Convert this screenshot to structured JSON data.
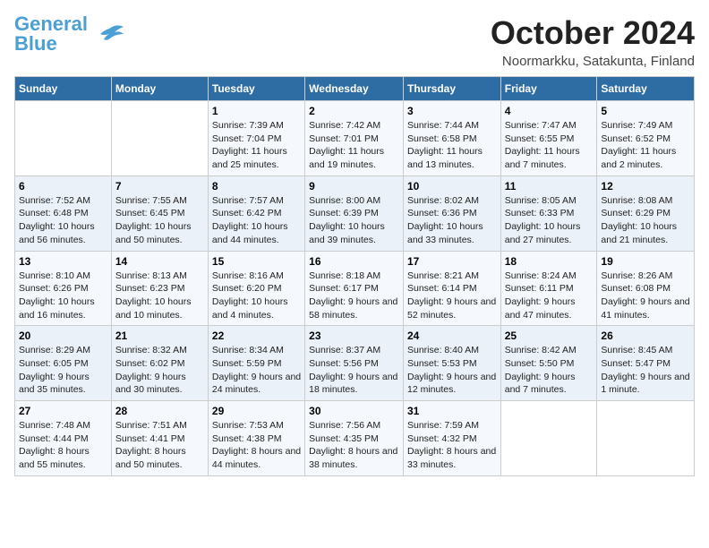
{
  "logo": {
    "line1": "General",
    "line2": "Blue"
  },
  "title": {
    "month_year": "October 2024",
    "location": "Noormarkku, Satakunta, Finland"
  },
  "days_of_week": [
    "Sunday",
    "Monday",
    "Tuesday",
    "Wednesday",
    "Thursday",
    "Friday",
    "Saturday"
  ],
  "weeks": [
    [
      {
        "day": "",
        "sunrise": "",
        "sunset": "",
        "daylight": ""
      },
      {
        "day": "",
        "sunrise": "",
        "sunset": "",
        "daylight": ""
      },
      {
        "day": "1",
        "sunrise": "Sunrise: 7:39 AM",
        "sunset": "Sunset: 7:04 PM",
        "daylight": "Daylight: 11 hours and 25 minutes."
      },
      {
        "day": "2",
        "sunrise": "Sunrise: 7:42 AM",
        "sunset": "Sunset: 7:01 PM",
        "daylight": "Daylight: 11 hours and 19 minutes."
      },
      {
        "day": "3",
        "sunrise": "Sunrise: 7:44 AM",
        "sunset": "Sunset: 6:58 PM",
        "daylight": "Daylight: 11 hours and 13 minutes."
      },
      {
        "day": "4",
        "sunrise": "Sunrise: 7:47 AM",
        "sunset": "Sunset: 6:55 PM",
        "daylight": "Daylight: 11 hours and 7 minutes."
      },
      {
        "day": "5",
        "sunrise": "Sunrise: 7:49 AM",
        "sunset": "Sunset: 6:52 PM",
        "daylight": "Daylight: 11 hours and 2 minutes."
      }
    ],
    [
      {
        "day": "6",
        "sunrise": "Sunrise: 7:52 AM",
        "sunset": "Sunset: 6:48 PM",
        "daylight": "Daylight: 10 hours and 56 minutes."
      },
      {
        "day": "7",
        "sunrise": "Sunrise: 7:55 AM",
        "sunset": "Sunset: 6:45 PM",
        "daylight": "Daylight: 10 hours and 50 minutes."
      },
      {
        "day": "8",
        "sunrise": "Sunrise: 7:57 AM",
        "sunset": "Sunset: 6:42 PM",
        "daylight": "Daylight: 10 hours and 44 minutes."
      },
      {
        "day": "9",
        "sunrise": "Sunrise: 8:00 AM",
        "sunset": "Sunset: 6:39 PM",
        "daylight": "Daylight: 10 hours and 39 minutes."
      },
      {
        "day": "10",
        "sunrise": "Sunrise: 8:02 AM",
        "sunset": "Sunset: 6:36 PM",
        "daylight": "Daylight: 10 hours and 33 minutes."
      },
      {
        "day": "11",
        "sunrise": "Sunrise: 8:05 AM",
        "sunset": "Sunset: 6:33 PM",
        "daylight": "Daylight: 10 hours and 27 minutes."
      },
      {
        "day": "12",
        "sunrise": "Sunrise: 8:08 AM",
        "sunset": "Sunset: 6:29 PM",
        "daylight": "Daylight: 10 hours and 21 minutes."
      }
    ],
    [
      {
        "day": "13",
        "sunrise": "Sunrise: 8:10 AM",
        "sunset": "Sunset: 6:26 PM",
        "daylight": "Daylight: 10 hours and 16 minutes."
      },
      {
        "day": "14",
        "sunrise": "Sunrise: 8:13 AM",
        "sunset": "Sunset: 6:23 PM",
        "daylight": "Daylight: 10 hours and 10 minutes."
      },
      {
        "day": "15",
        "sunrise": "Sunrise: 8:16 AM",
        "sunset": "Sunset: 6:20 PM",
        "daylight": "Daylight: 10 hours and 4 minutes."
      },
      {
        "day": "16",
        "sunrise": "Sunrise: 8:18 AM",
        "sunset": "Sunset: 6:17 PM",
        "daylight": "Daylight: 9 hours and 58 minutes."
      },
      {
        "day": "17",
        "sunrise": "Sunrise: 8:21 AM",
        "sunset": "Sunset: 6:14 PM",
        "daylight": "Daylight: 9 hours and 52 minutes."
      },
      {
        "day": "18",
        "sunrise": "Sunrise: 8:24 AM",
        "sunset": "Sunset: 6:11 PM",
        "daylight": "Daylight: 9 hours and 47 minutes."
      },
      {
        "day": "19",
        "sunrise": "Sunrise: 8:26 AM",
        "sunset": "Sunset: 6:08 PM",
        "daylight": "Daylight: 9 hours and 41 minutes."
      }
    ],
    [
      {
        "day": "20",
        "sunrise": "Sunrise: 8:29 AM",
        "sunset": "Sunset: 6:05 PM",
        "daylight": "Daylight: 9 hours and 35 minutes."
      },
      {
        "day": "21",
        "sunrise": "Sunrise: 8:32 AM",
        "sunset": "Sunset: 6:02 PM",
        "daylight": "Daylight: 9 hours and 30 minutes."
      },
      {
        "day": "22",
        "sunrise": "Sunrise: 8:34 AM",
        "sunset": "Sunset: 5:59 PM",
        "daylight": "Daylight: 9 hours and 24 minutes."
      },
      {
        "day": "23",
        "sunrise": "Sunrise: 8:37 AM",
        "sunset": "Sunset: 5:56 PM",
        "daylight": "Daylight: 9 hours and 18 minutes."
      },
      {
        "day": "24",
        "sunrise": "Sunrise: 8:40 AM",
        "sunset": "Sunset: 5:53 PM",
        "daylight": "Daylight: 9 hours and 12 minutes."
      },
      {
        "day": "25",
        "sunrise": "Sunrise: 8:42 AM",
        "sunset": "Sunset: 5:50 PM",
        "daylight": "Daylight: 9 hours and 7 minutes."
      },
      {
        "day": "26",
        "sunrise": "Sunrise: 8:45 AM",
        "sunset": "Sunset: 5:47 PM",
        "daylight": "Daylight: 9 hours and 1 minute."
      }
    ],
    [
      {
        "day": "27",
        "sunrise": "Sunrise: 7:48 AM",
        "sunset": "Sunset: 4:44 PM",
        "daylight": "Daylight: 8 hours and 55 minutes."
      },
      {
        "day": "28",
        "sunrise": "Sunrise: 7:51 AM",
        "sunset": "Sunset: 4:41 PM",
        "daylight": "Daylight: 8 hours and 50 minutes."
      },
      {
        "day": "29",
        "sunrise": "Sunrise: 7:53 AM",
        "sunset": "Sunset: 4:38 PM",
        "daylight": "Daylight: 8 hours and 44 minutes."
      },
      {
        "day": "30",
        "sunrise": "Sunrise: 7:56 AM",
        "sunset": "Sunset: 4:35 PM",
        "daylight": "Daylight: 8 hours and 38 minutes."
      },
      {
        "day": "31",
        "sunrise": "Sunrise: 7:59 AM",
        "sunset": "Sunset: 4:32 PM",
        "daylight": "Daylight: 8 hours and 33 minutes."
      },
      {
        "day": "",
        "sunrise": "",
        "sunset": "",
        "daylight": ""
      },
      {
        "day": "",
        "sunrise": "",
        "sunset": "",
        "daylight": ""
      }
    ]
  ]
}
